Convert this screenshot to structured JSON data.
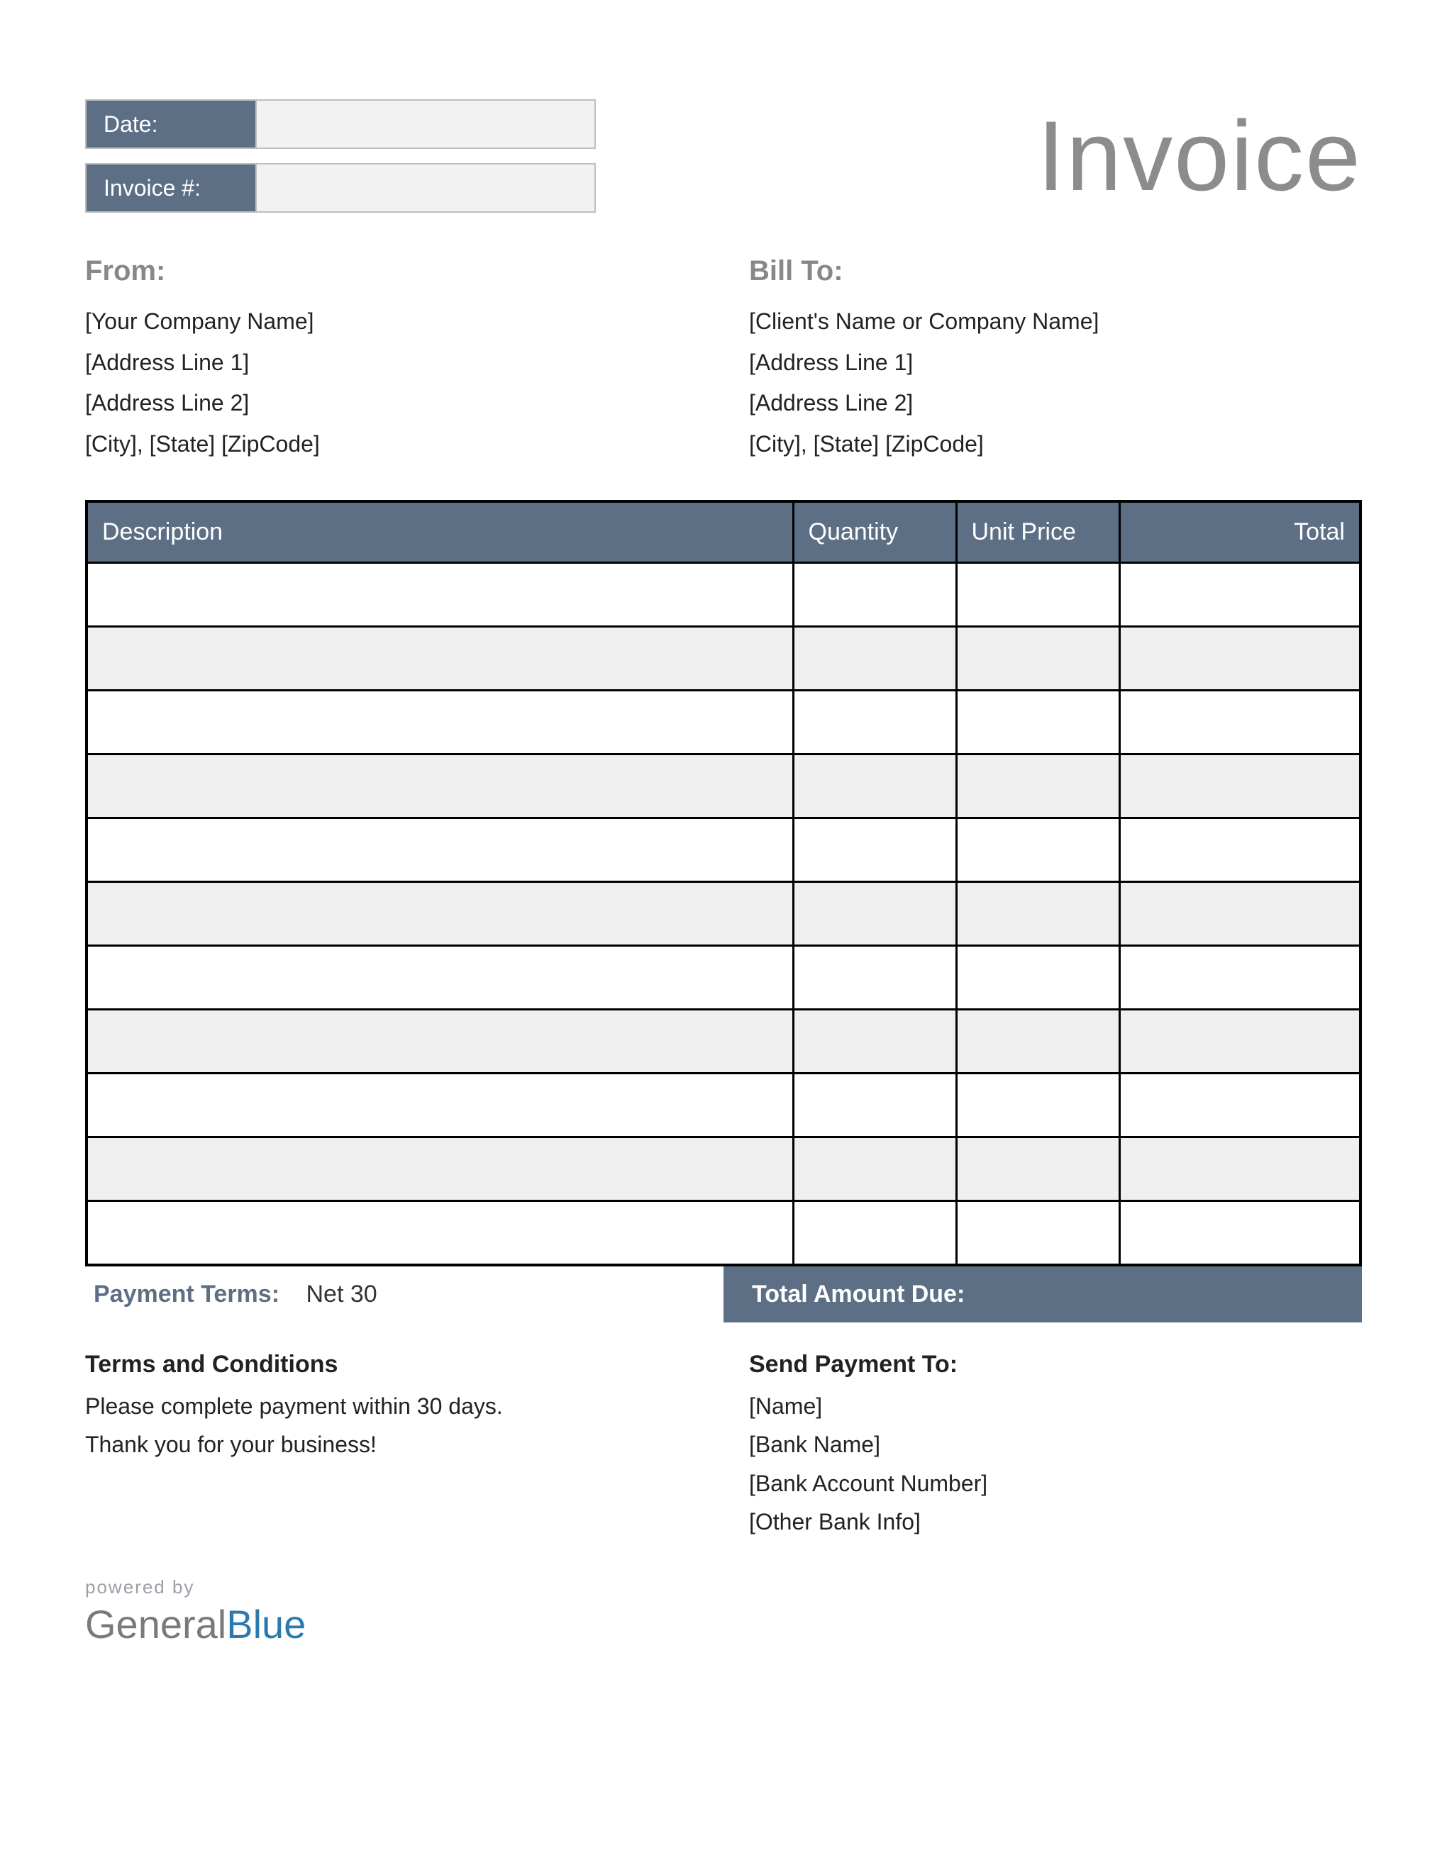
{
  "title": "Invoice",
  "meta": {
    "date_label": "Date:",
    "date_value": "",
    "invoice_no_label": "Invoice #:",
    "invoice_no_value": ""
  },
  "from": {
    "heading": "From:",
    "lines": [
      "[Your Company Name]",
      "[Address Line 1]",
      "[Address Line 2]",
      "[City], [State] [ZipCode]"
    ]
  },
  "bill_to": {
    "heading": "Bill To:",
    "lines": [
      "[Client's Name or Company Name]",
      "[Address Line 1]",
      "[Address Line 2]",
      "[City], [State] [ZipCode]"
    ]
  },
  "columns": {
    "description": "Description",
    "quantity": "Quantity",
    "unit_price": "Unit Price",
    "total": "Total"
  },
  "rows": [
    {
      "description": "",
      "quantity": "",
      "unit_price": "",
      "total": ""
    },
    {
      "description": "",
      "quantity": "",
      "unit_price": "",
      "total": ""
    },
    {
      "description": "",
      "quantity": "",
      "unit_price": "",
      "total": ""
    },
    {
      "description": "",
      "quantity": "",
      "unit_price": "",
      "total": ""
    },
    {
      "description": "",
      "quantity": "",
      "unit_price": "",
      "total": ""
    },
    {
      "description": "",
      "quantity": "",
      "unit_price": "",
      "total": ""
    },
    {
      "description": "",
      "quantity": "",
      "unit_price": "",
      "total": ""
    },
    {
      "description": "",
      "quantity": "",
      "unit_price": "",
      "total": ""
    },
    {
      "description": "",
      "quantity": "",
      "unit_price": "",
      "total": ""
    },
    {
      "description": "",
      "quantity": "",
      "unit_price": "",
      "total": ""
    },
    {
      "description": "",
      "quantity": "",
      "unit_price": "",
      "total": ""
    }
  ],
  "payment_terms": {
    "label": "Payment Terms:",
    "value": "Net 30"
  },
  "amount_due": {
    "label": "Total Amount Due:",
    "value": ""
  },
  "terms": {
    "heading": "Terms and Conditions",
    "lines": [
      "Please complete payment within 30 days.",
      "Thank you for your business!"
    ]
  },
  "send_payment": {
    "heading": "Send Payment To:",
    "lines": [
      "[Name]",
      "[Bank Name]",
      "[Bank Account Number]",
      "[Other Bank Info]"
    ]
  },
  "brand": {
    "powered": "powered by",
    "name1": "General",
    "name2": "Blue"
  }
}
